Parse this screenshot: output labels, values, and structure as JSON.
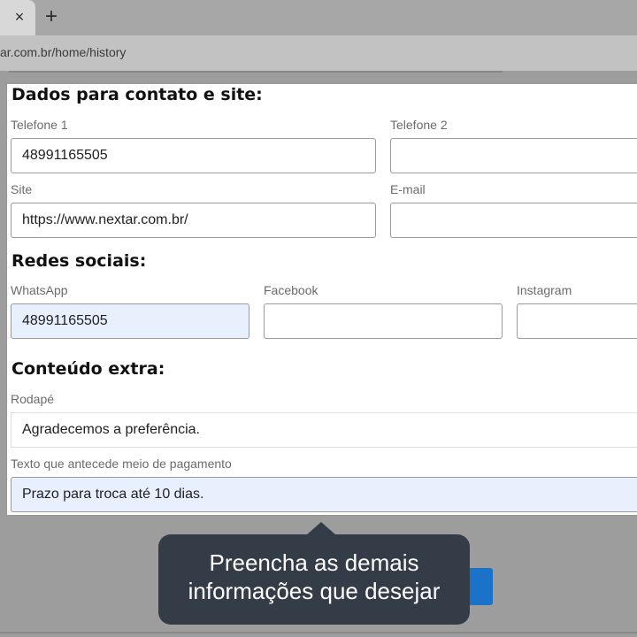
{
  "browser": {
    "tab_close_glyph": "×",
    "new_tab_glyph": "+",
    "url": "ar.com.br/home/history"
  },
  "form": {
    "contact_section": {
      "title": "Dados para contato e site:",
      "phone1_label": "Telefone 1",
      "phone1_value": "48991165505",
      "phone2_label": "Telefone 2",
      "phone2_value": "",
      "site_label": "Site",
      "site_value": "https://www.nextar.com.br/",
      "email_label": "E-mail",
      "email_value": ""
    },
    "social_section": {
      "title": "Redes sociais:",
      "whatsapp_label": "WhatsApp",
      "whatsapp_value": "48991165505",
      "facebook_label": "Facebook",
      "facebook_value": "",
      "instagram_label": "Instagram",
      "instagram_value": ""
    },
    "extra_section": {
      "title": "Conteúdo extra:",
      "footer_label": "Rodapé",
      "footer_value": "Agradecemos a preferência.",
      "payment_text_label": "Texto que antecede meio de pagamento",
      "payment_text_value": "Prazo para troca até 10 dias."
    }
  },
  "tooltip": {
    "line1": "Preencha as demais",
    "line2": "informações que desejar"
  },
  "colors": {
    "tooltip_bg": "#343c48",
    "autofill_bg": "#e8f0fe",
    "primary_button": "#1a73c9"
  }
}
